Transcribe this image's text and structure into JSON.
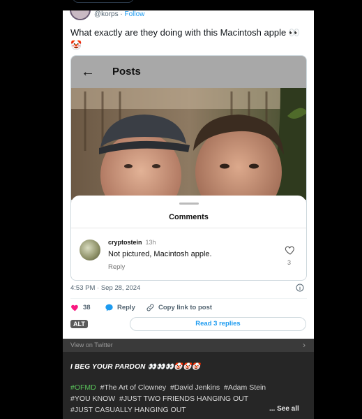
{
  "tweet": {
    "handle": "@korps",
    "separator": " · ",
    "follow_label": "Follow",
    "text": "What exactly are they doing with this Macintosh apple 👀🤡",
    "timestamp": "4:53 PM · Sep 28, 2024"
  },
  "embed": {
    "header_title": "Posts",
    "back_icon": "back-arrow-icon",
    "sheet_title": "Comments",
    "comment": {
      "username": "cryptostein",
      "time": "13h",
      "text": "Not pictured, Macintosh apple.",
      "reply_label": "Reply",
      "likes": "3"
    }
  },
  "actions": {
    "likes": "38",
    "reply_label": "Reply",
    "copy_label": "Copy link to post",
    "alt_label": "ALT",
    "read_replies": "Read 3 replies"
  },
  "view_on": "View on Twitter",
  "caption": {
    "text": "I BEG YOUR PARDON 👀👀👀🤡🤡🤡",
    "tag_first": "#OFMD",
    "tags_rest": "  #The Art of Clowney  #David Jenkins  #Adam Stein",
    "tags_line2": "#YOU KNOW  #JUST TWO FRIENDS HANGING OUT",
    "tags_line3": "#JUST CASUALLY HANGING OUT",
    "see_all": "... See all"
  },
  "colors": {
    "accent": "#1d9bf0",
    "heart": "#f91880",
    "tag_green": "#59c25a"
  }
}
